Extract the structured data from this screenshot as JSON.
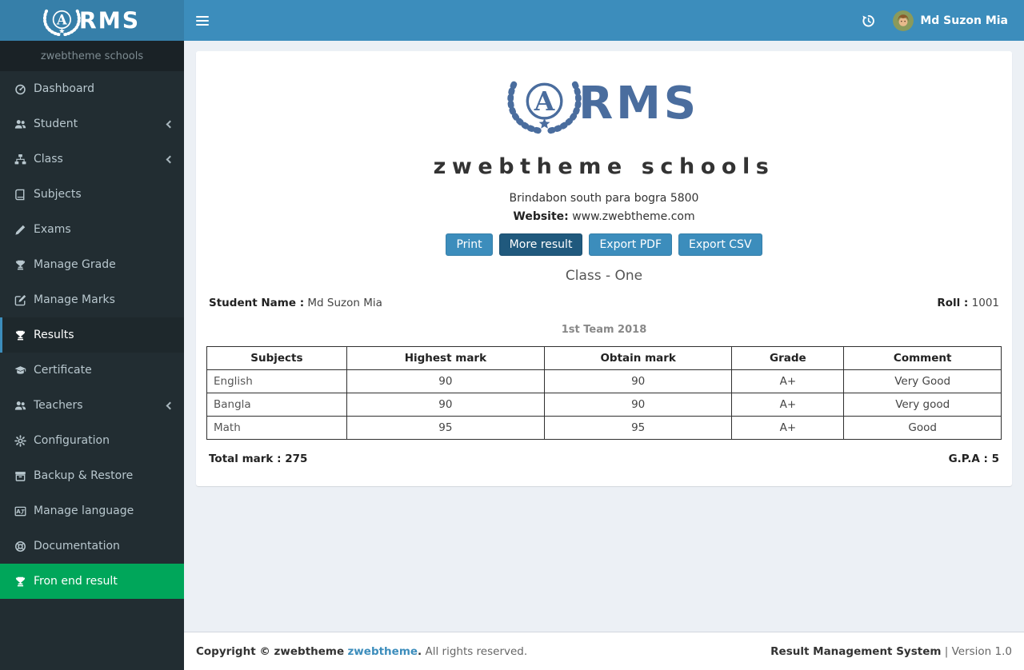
{
  "topbar": {
    "user_name": "Md Suzon Mia"
  },
  "sidebar": {
    "header": "zwebtheme schools",
    "items": [
      {
        "label": "Dashboard",
        "icon": "dashboard-icon"
      },
      {
        "label": "Student",
        "icon": "users-icon",
        "chevron": true
      },
      {
        "label": "Class",
        "icon": "sitemap-icon",
        "chevron": true
      },
      {
        "label": "Subjects",
        "icon": "book-icon"
      },
      {
        "label": "Exams",
        "icon": "pencil-icon"
      },
      {
        "label": "Manage Grade",
        "icon": "trophy-icon"
      },
      {
        "label": "Manage Marks",
        "icon": "edit-icon"
      },
      {
        "label": "Results",
        "icon": "trophy-icon",
        "active": true
      },
      {
        "label": "Certificate",
        "icon": "graduation-cap-icon"
      },
      {
        "label": "Teachers",
        "icon": "users-icon",
        "chevron": true
      },
      {
        "label": "Configuration",
        "icon": "gear-icon"
      },
      {
        "label": "Backup & Restore",
        "icon": "archive-icon"
      },
      {
        "label": "Manage language",
        "icon": "language-icon"
      },
      {
        "label": "Documentation",
        "icon": "life-ring-icon"
      },
      {
        "label": "Fron end result",
        "icon": "trophy-icon",
        "highlight": true
      }
    ]
  },
  "school": {
    "brand": "RMS",
    "name": "zwebtheme schools",
    "address": "Brindabon south para bogra 5800",
    "website_label": "Website:",
    "website": "www.zwebtheme.com"
  },
  "actions": {
    "print": "Print",
    "more_result": "More result",
    "export_pdf": "Export PDF",
    "export_csv": "Export CSV"
  },
  "result": {
    "class_title": "Class - One",
    "student_name_label": "Student Name :",
    "student_name": "Md Suzon Mia",
    "roll_label": "Roll :",
    "roll": "1001",
    "term": "1st Team 2018",
    "total_label": "Total mark :",
    "total": "275",
    "gpa_label": "G.P.A :",
    "gpa": "5"
  },
  "table": {
    "headers": [
      "Subjects",
      "Highest mark",
      "Obtain mark",
      "Grade",
      "Comment"
    ],
    "rows": [
      [
        "English",
        "90",
        "90",
        "A+",
        "Very Good"
      ],
      [
        "Bangla",
        "90",
        "90",
        "A+",
        "Very good"
      ],
      [
        "Math",
        "95",
        "95",
        "A+",
        "Good"
      ]
    ]
  },
  "footer": {
    "left_bold": "Copyright © zwebtheme",
    "link": "zwebtheme",
    "dot": ".",
    "left_rest": "All rights reserved.",
    "right_title": "Result Management System",
    "right_version": "| Version 1.0"
  },
  "colors": {
    "navbar": "#3c8dbc",
    "logo_bg": "#367fa9",
    "sidebar_bg": "#222d32",
    "sidebar_header_bg": "#1a2226",
    "active_item_bg": "#1e282c",
    "highlight_green": "#00a65a",
    "content_bg": "#ecf0f5",
    "brand_blue": "#4a6d9e",
    "button_blue": "#3c8dbc",
    "button_dark": "#20597d"
  }
}
